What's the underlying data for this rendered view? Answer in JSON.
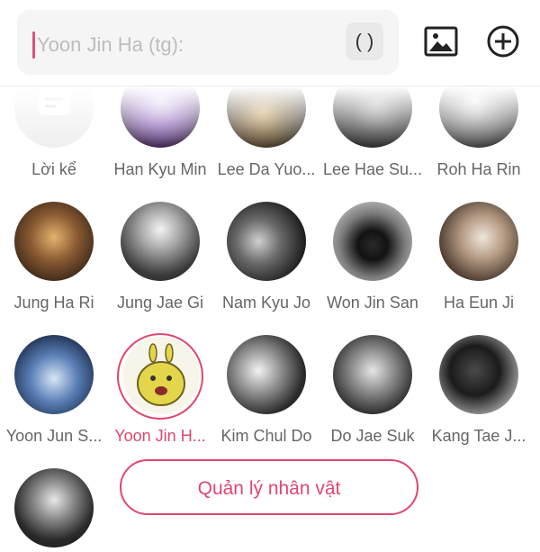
{
  "input": {
    "placeholder": "Yoon Jin Ha (tg):",
    "paren_label": "( )"
  },
  "toolbar": {
    "image_icon": "image-icon",
    "add_icon": "add-circle-icon"
  },
  "characters": [
    {
      "name": "Lời kể"
    },
    {
      "name": "Han Kyu Min"
    },
    {
      "name": "Lee Da Yuo..."
    },
    {
      "name": "Lee Hae Su..."
    },
    {
      "name": "Roh Ha Rin"
    },
    {
      "name": "Jung Ha Ri"
    },
    {
      "name": "Jung Jae Gi"
    },
    {
      "name": "Nam Kyu Jo"
    },
    {
      "name": "Won Jin San"
    },
    {
      "name": "Ha Eun Ji"
    },
    {
      "name": "Yoon Jun S..."
    },
    {
      "name": "Yoon Jin H..."
    },
    {
      "name": "Kim Chul Do"
    },
    {
      "name": "Do Jae Suk"
    },
    {
      "name": "Kang Tae J..."
    },
    {
      "name": ""
    }
  ],
  "manage_button": {
    "label": "Quản lý nhân vật"
  },
  "colors": {
    "accent": "#e0466e",
    "caret": "#e0507a"
  }
}
